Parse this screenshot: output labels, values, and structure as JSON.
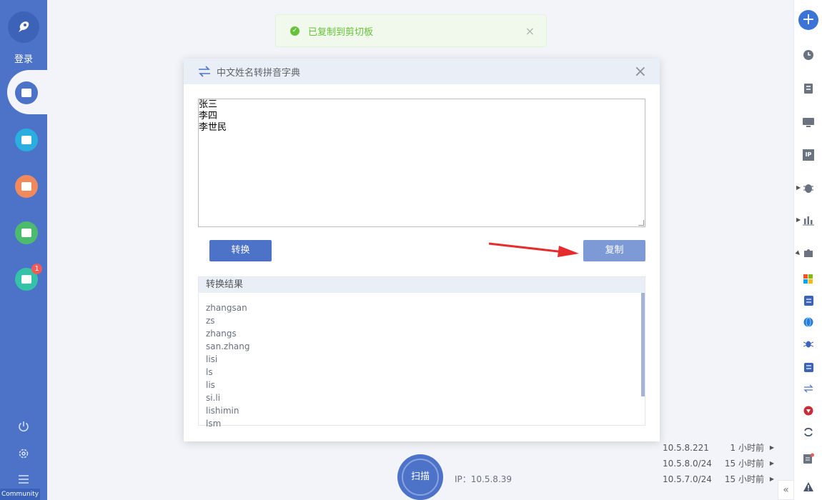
{
  "sidebar": {
    "login_label": "登录",
    "nav_badge": "1",
    "community_label": "Community",
    "nav_colors": [
      "#4d73c8",
      "#2aaee0",
      "#f08a5d",
      "#4dbb6d",
      "#35c3a7"
    ]
  },
  "toast": {
    "message": "已复制到剪切板",
    "close_glyph": "×"
  },
  "dialog": {
    "title": "中文姓名转拼音字典",
    "close_glyph": "×",
    "input_lines": [
      "张三",
      "李四",
      "李世民"
    ],
    "convert_label": "转换",
    "copy_label": "复制",
    "results_header": "转换结果",
    "results": [
      "zhangsan",
      "zs",
      "zhangs",
      "san.zhang",
      "lisi",
      "ls",
      "lis",
      "si.li",
      "lishimin",
      "lsm"
    ]
  },
  "scan": {
    "label": "扫描",
    "ip_text": "IP：10.5.8.39"
  },
  "history": [
    {
      "ip": "10.5.8.221",
      "time": "1 小时前"
    },
    {
      "ip": "10.5.8.0/24",
      "time": "15 小时前"
    },
    {
      "ip": "10.5.7.0/24",
      "time": "15 小时前"
    }
  ],
  "right_toolbar": {
    "add_glyph": "+",
    "icons": [
      "clock-icon",
      "document-icon",
      "monitor-icon",
      "ip-icon",
      "bug-icon",
      "chart-icon",
      "plugin-icon",
      "windows-icon",
      "doc-list-icon",
      "globe-icon",
      "spider-icon",
      "checklist-icon",
      "swap-icon",
      "shield-icon",
      "refresh-icon",
      "report-icon",
      "warning-icon"
    ],
    "ip_icon_text": "IP",
    "collapse_glyph": "«"
  },
  "colors": {
    "primary": "#4d73c8",
    "success": "#67c23a",
    "danger": "#f25a5a"
  }
}
